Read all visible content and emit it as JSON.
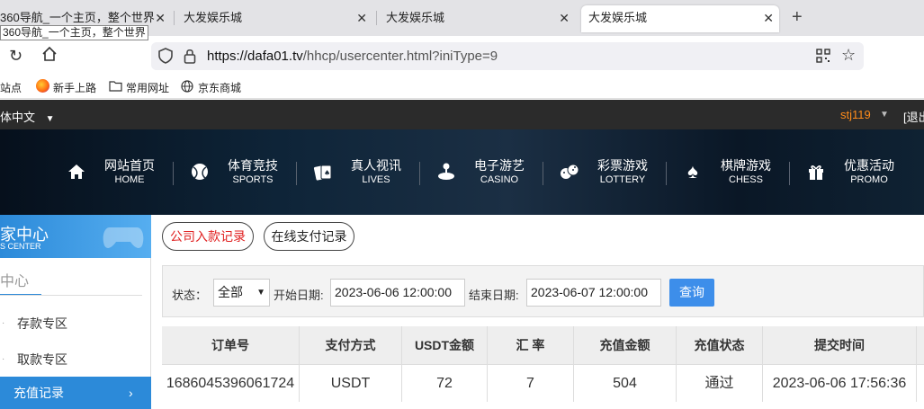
{
  "browser": {
    "tabs": [
      {
        "title": "360导航_一个主页，整个世界"
      },
      {
        "title": "大发娱乐城"
      },
      {
        "title": "大发娱乐城"
      },
      {
        "title": "大发娱乐城"
      }
    ],
    "tooltip": "360导航_一个主页，整个世界",
    "url_domain": "https://dafa01.tv",
    "url_path": "/hhcp/usercenter.html?iniType=9",
    "bookmarks": [
      "站点",
      "新手上路",
      "常用网址",
      "京东商城"
    ]
  },
  "site": {
    "language": "体中文",
    "username": "stj119",
    "logout": "[退出",
    "nav": [
      {
        "zh": "网站首页",
        "en": "HOME",
        "icon": "home-icon"
      },
      {
        "zh": "体育竞技",
        "en": "SPORTS",
        "icon": "ball-icon"
      },
      {
        "zh": "真人视讯",
        "en": "LIVES",
        "icon": "cards-icon"
      },
      {
        "zh": "电子游艺",
        "en": "CASINO",
        "icon": "joystick-icon"
      },
      {
        "zh": "彩票游戏",
        "en": "LOTTERY",
        "icon": "dice-icon"
      },
      {
        "zh": "棋牌游戏",
        "en": "CHESS",
        "icon": "spade-icon"
      },
      {
        "zh": "优惠活动",
        "en": "PROMO",
        "icon": "gift-icon"
      }
    ]
  },
  "sidebar": {
    "head_zh": "家中心",
    "head_en": "S CENTER",
    "title": "中心",
    "items": [
      {
        "label": "存款专区"
      },
      {
        "label": "取款专区"
      },
      {
        "label": "充值记录"
      }
    ]
  },
  "tabs": {
    "company_deposit": "公司入款记录",
    "online_payment": "在线支付记录"
  },
  "filter": {
    "status_label": "状态：",
    "status_value": "全部",
    "start_label": "开始日期:",
    "start_value": "2023-06-06 12:00:00",
    "end_label": "结束日期:",
    "end_value": "2023-06-07 12:00:00",
    "query_label": "查询"
  },
  "table": {
    "headers": [
      "订单号",
      "支付方式",
      "USDT金额",
      "汇 率",
      "充值金额",
      "充值状态",
      "提交时间"
    ],
    "rows": [
      [
        "1686045396061724",
        "USDT",
        "72",
        "7",
        "504",
        "通过",
        "2023-06-06 17:56:36"
      ]
    ]
  },
  "colors": {
    "accent": "#3d8eea",
    "active_pill": "#e02020",
    "username": "#ff8c1a"
  }
}
